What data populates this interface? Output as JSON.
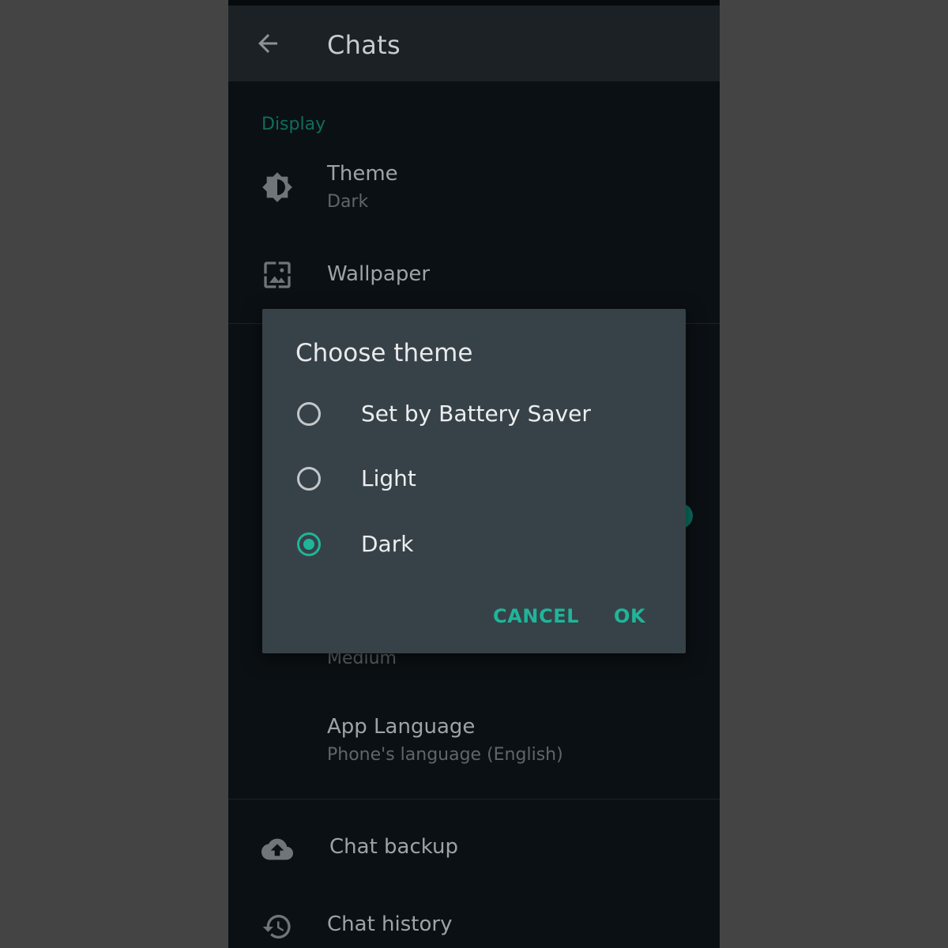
{
  "appbar": {
    "title": "Chats"
  },
  "display_section": {
    "label": "Display",
    "theme": {
      "title": "Theme",
      "value": "Dark"
    },
    "wallpaper": {
      "title": "Wallpaper"
    },
    "font_size": {
      "value": "Medium"
    },
    "app_language": {
      "title": "App Language",
      "value": "Phone's language (English)"
    }
  },
  "bottom_items": {
    "chat_backup": "Chat backup",
    "chat_history": "Chat history"
  },
  "dialog": {
    "title": "Choose theme",
    "options": [
      {
        "label": "Set by Battery Saver",
        "selected": false
      },
      {
        "label": "Light",
        "selected": false
      },
      {
        "label": "Dark",
        "selected": true
      }
    ],
    "cancel_label": "CANCEL",
    "ok_label": "OK"
  },
  "colors": {
    "accent": "#1fb59a",
    "dialog_bg": "#374248",
    "app_bg": "#0b1014"
  },
  "icons": [
    "back-arrow-icon",
    "brightness-icon",
    "wallpaper-icon",
    "cloud-upload-icon",
    "history-icon"
  ]
}
